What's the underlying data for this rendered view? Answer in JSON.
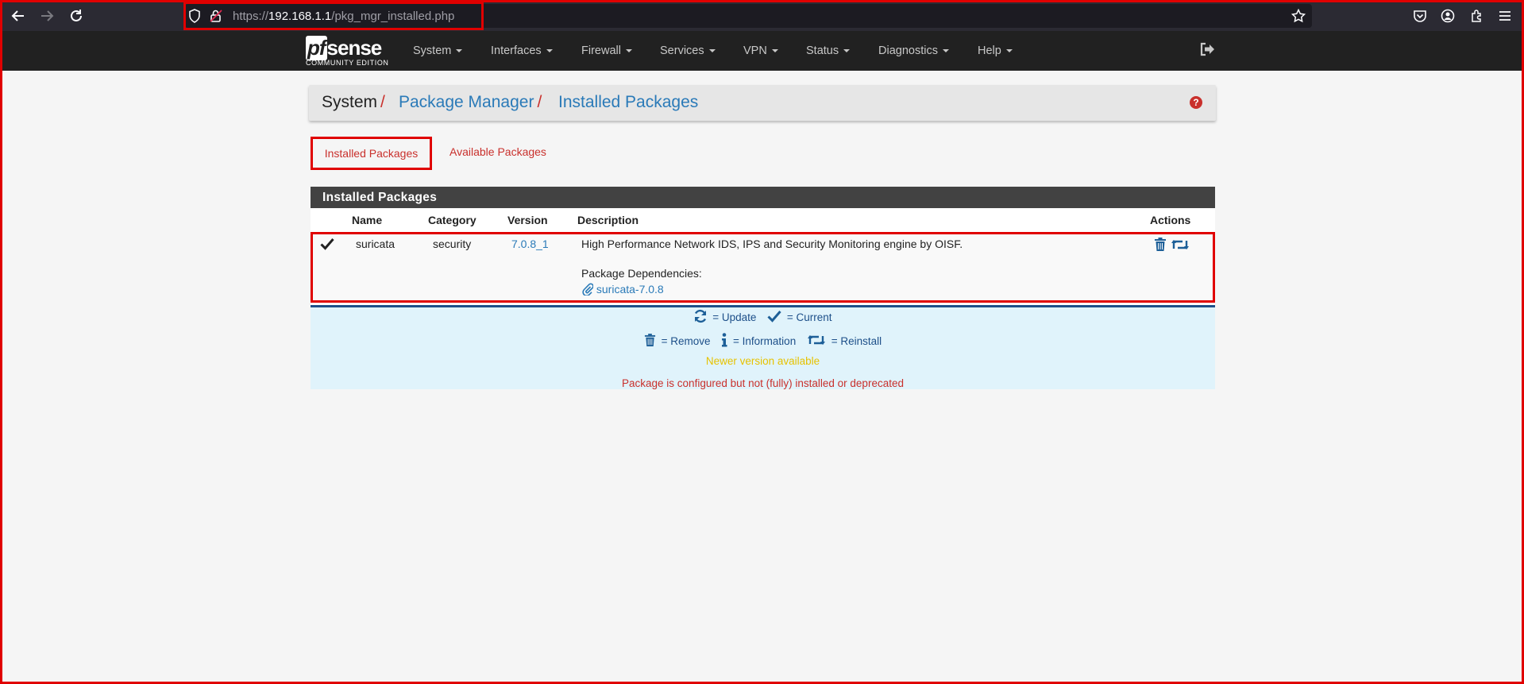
{
  "browser": {
    "url_scheme": "https://",
    "url_host": "192.168.1.1",
    "url_path": "/pkg_mgr_installed.php"
  },
  "navbar": {
    "logo_main": "sense",
    "logo_pf": "pf",
    "logo_sub": "COMMUNITY EDITION",
    "menu": [
      "System",
      "Interfaces",
      "Firewall",
      "Services",
      "VPN",
      "Status",
      "Diagnostics",
      "Help"
    ]
  },
  "breadcrumb": {
    "root": "System",
    "separator": "/",
    "section": "Package Manager",
    "page": "Installed Packages",
    "help_glyph": "?"
  },
  "tabs": {
    "installed": "Installed Packages",
    "available": "Available Packages"
  },
  "panel": {
    "title": "Installed Packages",
    "columns": {
      "name": "Name",
      "category": "Category",
      "version": "Version",
      "description": "Description",
      "actions": "Actions"
    },
    "rows": [
      {
        "status_icon": "check-icon",
        "name": "suricata",
        "category": "security",
        "version": "7.0.8_1",
        "description": "High Performance Network IDS, IPS and Security Monitoring engine by OISF.",
        "deps_label": "Package Dependencies:",
        "dependency": "suricata-7.0.8"
      }
    ]
  },
  "legend": {
    "update": "= Update",
    "current": "= Current",
    "remove": "= Remove",
    "information": "= Information",
    "reinstall": "= Reinstall",
    "newer": "Newer version available",
    "deprecated": "Package is configured but not (fully) installed or deprecated"
  },
  "colors": {
    "accent_red": "#c9302c",
    "link_blue": "#2a7ab8",
    "legend_bg": "#e0f3fb",
    "newer_yellow": "#e6c200",
    "annotation_red": "#e00000"
  }
}
